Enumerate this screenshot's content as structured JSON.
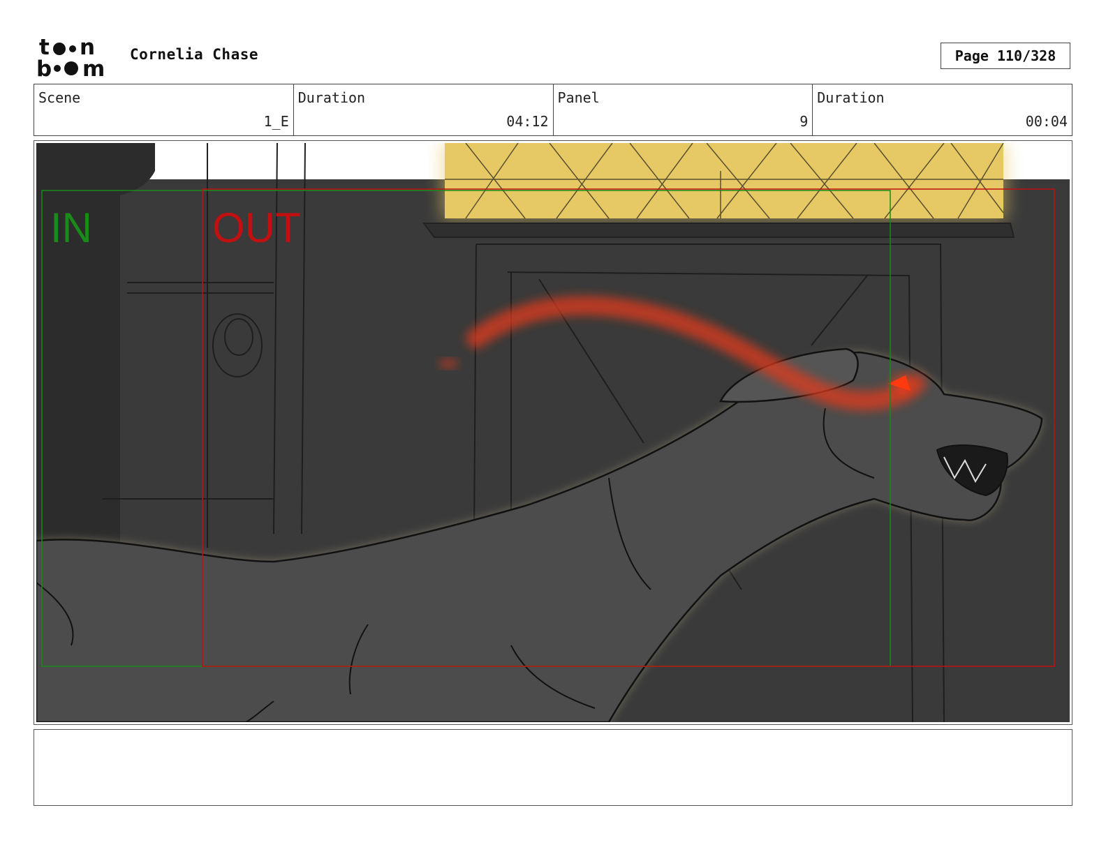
{
  "header": {
    "logo_text": "toon boom",
    "project_title": "Cornelia Chase",
    "page_label": "Page 110/328"
  },
  "info": {
    "scene_label": "Scene",
    "scene_value": "1_E",
    "scene_duration_label": "Duration",
    "scene_duration_value": "04:12",
    "panel_label": "Panel",
    "panel_value": "9",
    "panel_duration_label": "Duration",
    "panel_duration_value": "00:04"
  },
  "panel": {
    "in_label": "IN",
    "out_label": "OUT",
    "colors": {
      "in_frame": "#1a8a1a",
      "out_frame": "#c01010",
      "background": "#3a3a3a",
      "creature": "#4c4c4c",
      "window_light": "#e6c964",
      "eye_glow": "#e03a1a"
    }
  },
  "notes": {
    "text": ""
  }
}
